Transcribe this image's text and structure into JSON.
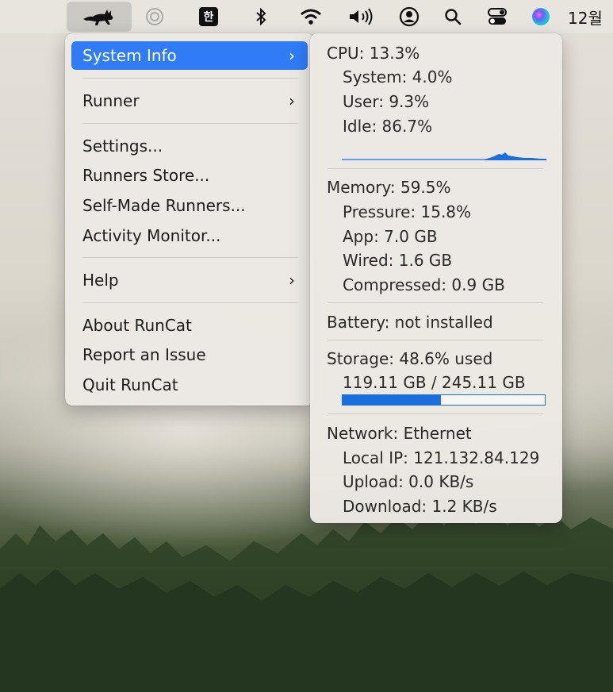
{
  "menubar": {
    "ime_label": "한",
    "clock": "12월"
  },
  "menu": {
    "items": [
      {
        "label": "System Info",
        "submenu": true
      },
      {
        "label": "Runner",
        "submenu": true
      },
      {
        "label": "Settings..."
      },
      {
        "label": "Runners Store..."
      },
      {
        "label": "Self-Made Runners..."
      },
      {
        "label": "Activity Monitor..."
      },
      {
        "label": "Help",
        "submenu": true
      },
      {
        "label": "About RunCat"
      },
      {
        "label": "Report an Issue"
      },
      {
        "label": "Quit RunCat"
      }
    ],
    "chevron": "›"
  },
  "sysinfo": {
    "cpu": {
      "title": "CPU: 13.3%",
      "system": "System:  4.0%",
      "user": "User:  9.3%",
      "idle": "Idle: 86.7%"
    },
    "memory": {
      "title": "Memory: 59.5%",
      "pressure": "Pressure: 15.8%",
      "app": "App:  7.0 GB",
      "wired": "Wired:  1.6 GB",
      "compressed": "Compressed:  0.9 GB"
    },
    "battery": "Battery: not installed",
    "storage": {
      "title": "Storage: 48.6% used",
      "detail": "119.11 GB / 245.11 GB",
      "fraction": 0.486
    },
    "network": {
      "title": "Network: Ethernet",
      "local_ip": "Local IP: 121.132.84.129",
      "upload": "Upload:   0.0 KB/s",
      "download": "Download:   1.2 KB/s"
    }
  },
  "colors": {
    "accent": "#2f7cf6",
    "storage_bar": "#1a6fe0"
  }
}
